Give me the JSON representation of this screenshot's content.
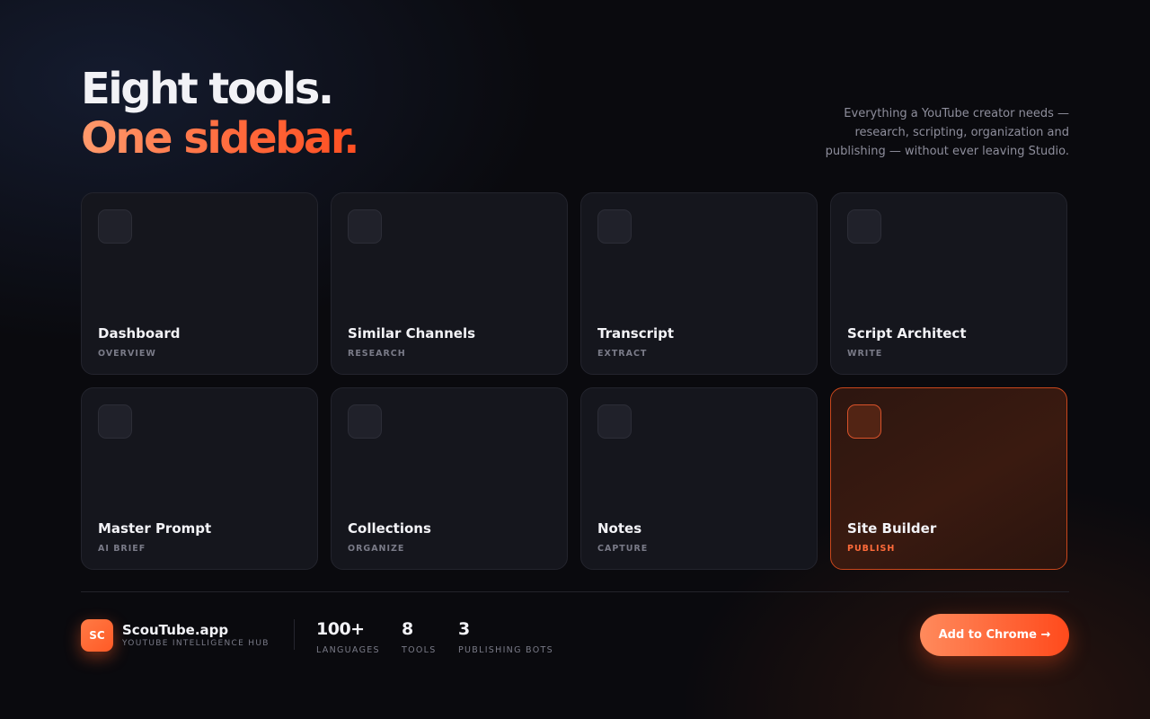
{
  "hero": {
    "headline_line1": "Eight tools.",
    "headline_line2": "One sidebar.",
    "description": "Everything a YouTube creator needs — research, scripting, organization and publishing — without ever leaving Studio."
  },
  "tools": [
    {
      "title": "Dashboard",
      "subtitle": "OVERVIEW",
      "active": false
    },
    {
      "title": "Similar Channels",
      "subtitle": "RESEARCH",
      "active": false
    },
    {
      "title": "Transcript",
      "subtitle": "EXTRACT",
      "active": false
    },
    {
      "title": "Script Architect",
      "subtitle": "WRITE",
      "active": false
    },
    {
      "title": "Master Prompt",
      "subtitle": "AI BRIEF",
      "active": false
    },
    {
      "title": "Collections",
      "subtitle": "ORGANIZE",
      "active": false
    },
    {
      "title": "Notes",
      "subtitle": "CAPTURE",
      "active": false
    },
    {
      "title": "Site Builder",
      "subtitle": "PUBLISH",
      "active": true
    }
  ],
  "footer": {
    "brand": {
      "logo_text": "SC",
      "name": "ScouTube.app",
      "tagline": "YOUTUBE INTELLIGENCE HUB"
    },
    "stats": [
      {
        "value": "100+",
        "label": "LANGUAGES"
      },
      {
        "value": "8",
        "label": "TOOLS"
      },
      {
        "value": "3",
        "label": "PUBLISHING BOTS"
      }
    ],
    "cta_label": "Add to Chrome →"
  },
  "colors": {
    "background": "#0a0a0e",
    "card": "#15161d",
    "accent": "#ff6a3c",
    "active_border": "#c9471c"
  }
}
